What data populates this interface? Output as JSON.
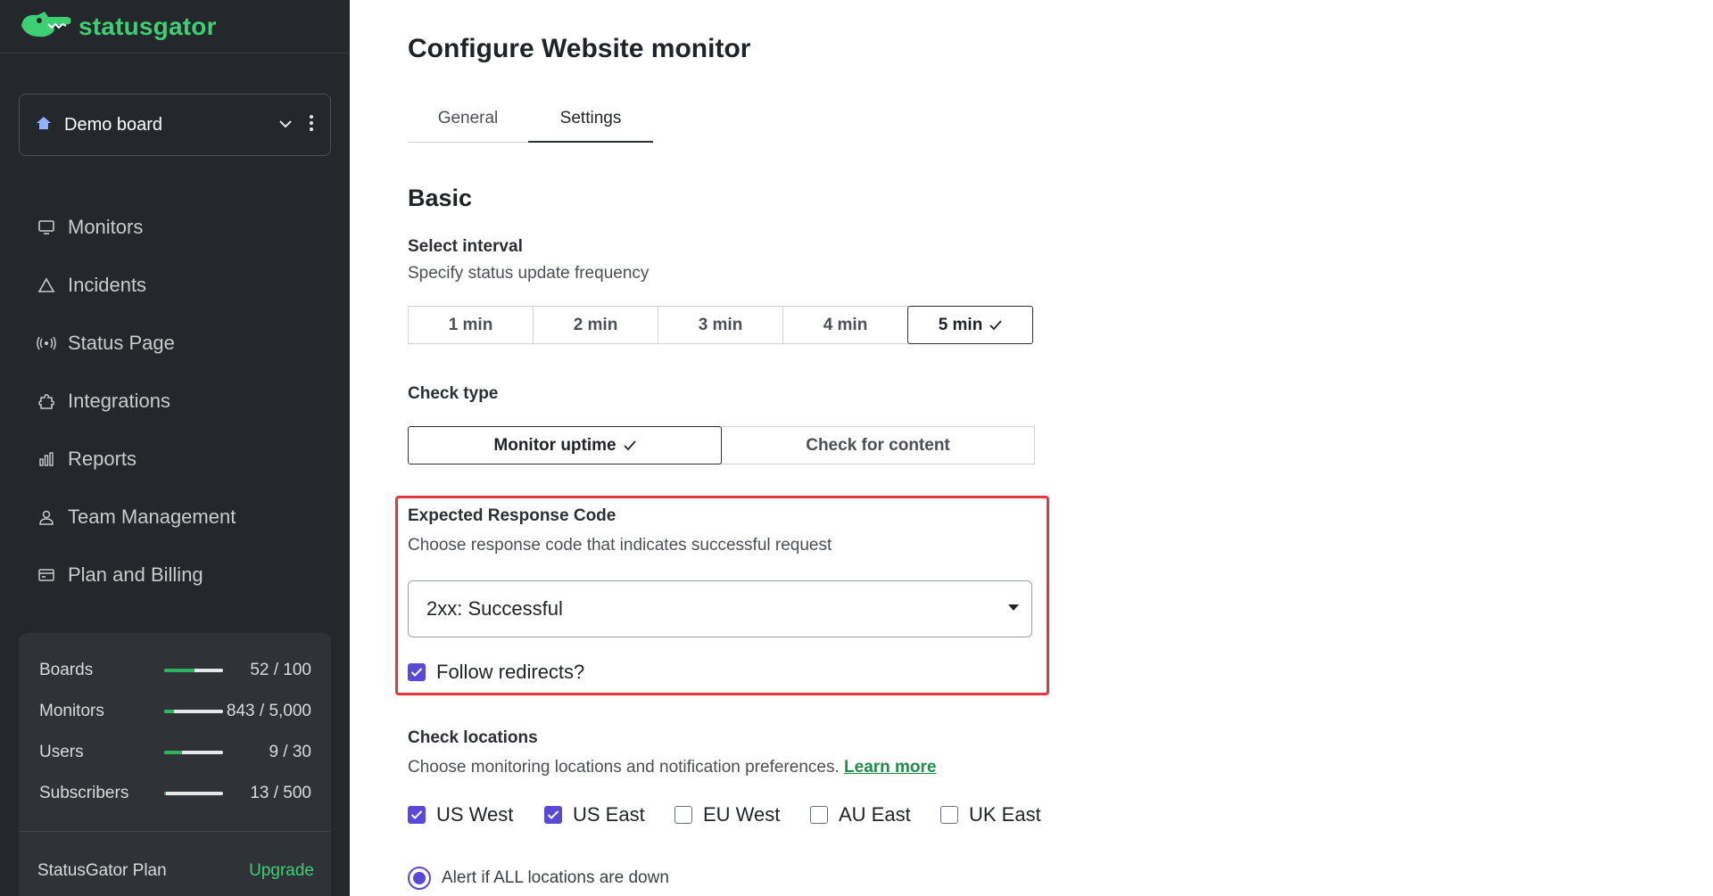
{
  "brand": {
    "name": "statusgator",
    "accent": "#3dcf74"
  },
  "sidebar": {
    "board": {
      "name": "Demo board"
    },
    "items": [
      {
        "label": "Monitors",
        "icon": "monitor-icon"
      },
      {
        "label": "Incidents",
        "icon": "warning-triangle-icon"
      },
      {
        "label": "Status Page",
        "icon": "broadcast-icon"
      },
      {
        "label": "Integrations",
        "icon": "puzzle-icon"
      },
      {
        "label": "Reports",
        "icon": "bar-chart-icon"
      },
      {
        "label": "Team Management",
        "icon": "user-icon"
      },
      {
        "label": "Plan and Billing",
        "icon": "credit-card-icon"
      }
    ],
    "usage": [
      {
        "label": "Boards",
        "value": "52 / 100",
        "fraction": 0.52
      },
      {
        "label": "Monitors",
        "value": "843 / 5,000",
        "fraction": 0.1686
      },
      {
        "label": "Users",
        "value": "9 / 30",
        "fraction": 0.3
      },
      {
        "label": "Subscribers",
        "value": "13 / 500",
        "fraction": 0.026
      }
    ],
    "plan": {
      "label": "StatusGator Plan",
      "upgrade": "Upgrade"
    }
  },
  "main": {
    "title": "Configure Website monitor",
    "tabs": [
      {
        "label": "General"
      },
      {
        "label": "Settings",
        "active": true
      }
    ],
    "section": "Basic",
    "interval": {
      "label": "Select interval",
      "help": "Specify status update frequency",
      "options": [
        "1 min",
        "2 min",
        "3 min",
        "4 min",
        "5 min"
      ],
      "selected": "5 min"
    },
    "check_type": {
      "label": "Check type",
      "options": [
        "Monitor uptime",
        "Check for content"
      ],
      "selected": "Monitor uptime"
    },
    "response": {
      "label": "Expected Response Code",
      "help": "Choose response code that indicates successful request",
      "selected": "2xx: Successful",
      "follow_redirects_label": "Follow redirects?",
      "follow_redirects": true
    },
    "locations": {
      "label": "Check locations",
      "help": "Choose monitoring locations and notification preferences.",
      "learn_more": "Learn more",
      "items": [
        {
          "label": "US West",
          "checked": true
        },
        {
          "label": "US East",
          "checked": true
        },
        {
          "label": "EU West",
          "checked": false
        },
        {
          "label": "AU East",
          "checked": false
        },
        {
          "label": "UK East",
          "checked": false
        }
      ]
    },
    "alert_option": "Alert if ALL locations are down",
    "highlight_color": "#e5363d"
  }
}
